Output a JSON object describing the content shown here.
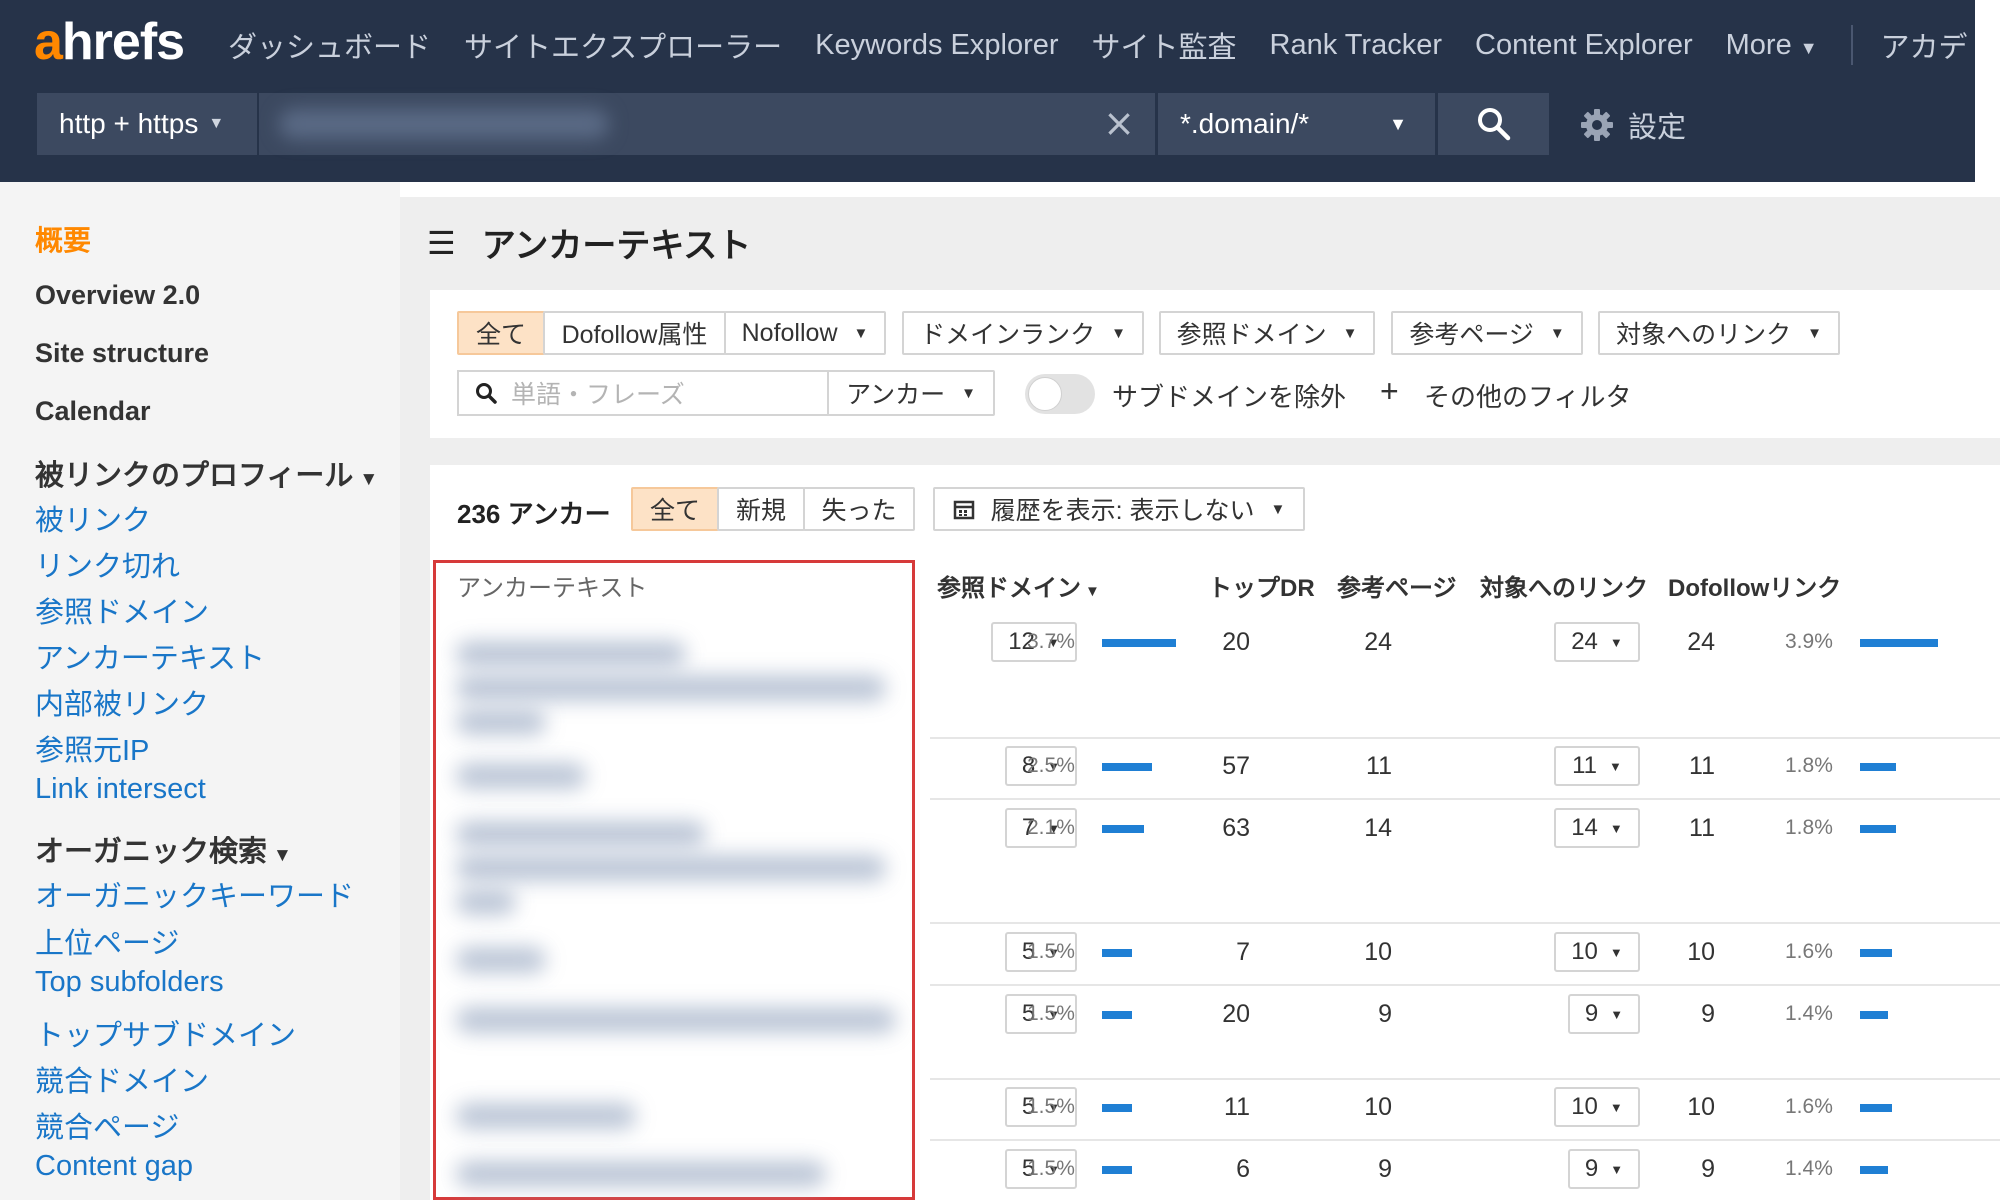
{
  "app": {
    "logo_a": "a",
    "logo_rest": "hrefs",
    "nav": [
      {
        "label": "ダッシュボード"
      },
      {
        "label": "サイトエクスプローラー"
      },
      {
        "label": "Keywords Explorer"
      },
      {
        "label": "サイト監査"
      },
      {
        "label": "Rank Tracker"
      },
      {
        "label": "Content Explorer"
      },
      {
        "label": "More",
        "caret": "▼"
      },
      {
        "label": "アカデ"
      }
    ]
  },
  "search": {
    "protocol": "http + https",
    "mode": "*.domain/*",
    "clear_icon": "×",
    "settings_label": "設定"
  },
  "sidebar": {
    "active": "概要",
    "items_top": [
      "Overview 2.0",
      "Site structure",
      "Calendar"
    ],
    "backlink_heading": "被リンクのプロフィール",
    "backlink_links": [
      "被リンク",
      "リンク切れ",
      "参照ドメイン",
      "アンカーテキスト",
      "内部被リンク",
      "参照元IP",
      "Link intersect"
    ],
    "organic_heading": "オーガニック検索",
    "organic_links": [
      "オーガニックキーワード",
      "上位ページ",
      "Top subfolders",
      "トップサブドメイン",
      "競合ドメイン",
      "競合ページ",
      "Content gap"
    ]
  },
  "page": {
    "title": "アンカーテキスト",
    "filters": {
      "all": "全て",
      "dofollow": "Dofollow属性",
      "nofollow": "Nofollow",
      "domain_rank": "ドメインランク",
      "ref_domains": "参照ドメイン",
      "ref_pages": "参考ページ",
      "links_to_target": "対象へのリンク",
      "search_placeholder": "単語・フレーズ",
      "search_scope": "アンカー",
      "exclude_subdomains": "サブドメインを除外",
      "more_filters": "その他のフィルタ",
      "plus": "+"
    },
    "count_label": "236 アンカー",
    "tabs": [
      "全て",
      "新規",
      "失った"
    ],
    "history": "履歴を表示: 表示しない"
  },
  "table": {
    "headers": {
      "anchor": "アンカーテキスト",
      "ref_domains": "参照ドメイン",
      "top_dr": "トップDR",
      "ref_pages": "参考ページ",
      "links_to_target": "対象へのリンク",
      "dofollow": "Dofollowリンク"
    },
    "rows": [
      {
        "ref": "12",
        "ref_pct": "3.7%",
        "ref_frac": 0.037,
        "dr": "20",
        "pages": "24",
        "links": "24",
        "dofollow": "24",
        "do_pct": "3.9%",
        "do_frac": 0.039
      },
      {
        "ref": "8",
        "ref_pct": "2.5%",
        "ref_frac": 0.025,
        "dr": "57",
        "pages": "11",
        "links": "11",
        "dofollow": "11",
        "do_pct": "1.8%",
        "do_frac": 0.018
      },
      {
        "ref": "7",
        "ref_pct": "2.1%",
        "ref_frac": 0.021,
        "dr": "63",
        "pages": "14",
        "links": "14",
        "dofollow": "11",
        "do_pct": "1.8%",
        "do_frac": 0.018
      },
      {
        "ref": "5",
        "ref_pct": "1.5%",
        "ref_frac": 0.015,
        "dr": "7",
        "pages": "10",
        "links": "10",
        "dofollow": "10",
        "do_pct": "1.6%",
        "do_frac": 0.016
      },
      {
        "ref": "5",
        "ref_pct": "1.5%",
        "ref_frac": 0.015,
        "dr": "20",
        "pages": "9",
        "links": "9",
        "dofollow": "9",
        "do_pct": "1.4%",
        "do_frac": 0.014
      },
      {
        "ref": "5",
        "ref_pct": "1.5%",
        "ref_frac": 0.015,
        "dr": "11",
        "pages": "10",
        "links": "10",
        "dofollow": "10",
        "do_pct": "1.6%",
        "do_frac": 0.016
      },
      {
        "ref": "5",
        "ref_pct": "1.5%",
        "ref_frac": 0.015,
        "dr": "6",
        "pages": "9",
        "links": "9",
        "dofollow": "9",
        "do_pct": "1.4%",
        "do_frac": 0.014
      }
    ]
  },
  "colors": {
    "topbar": "#263349",
    "accent": "#ff8800",
    "link": "#1976c8",
    "bar": "#1f7fd4",
    "highlight_border": "#d63a3a"
  },
  "icons": {
    "search": "search-icon",
    "gear": "gear-icon",
    "calendar": "calendar-icon",
    "menu": "hamburger-icon"
  }
}
